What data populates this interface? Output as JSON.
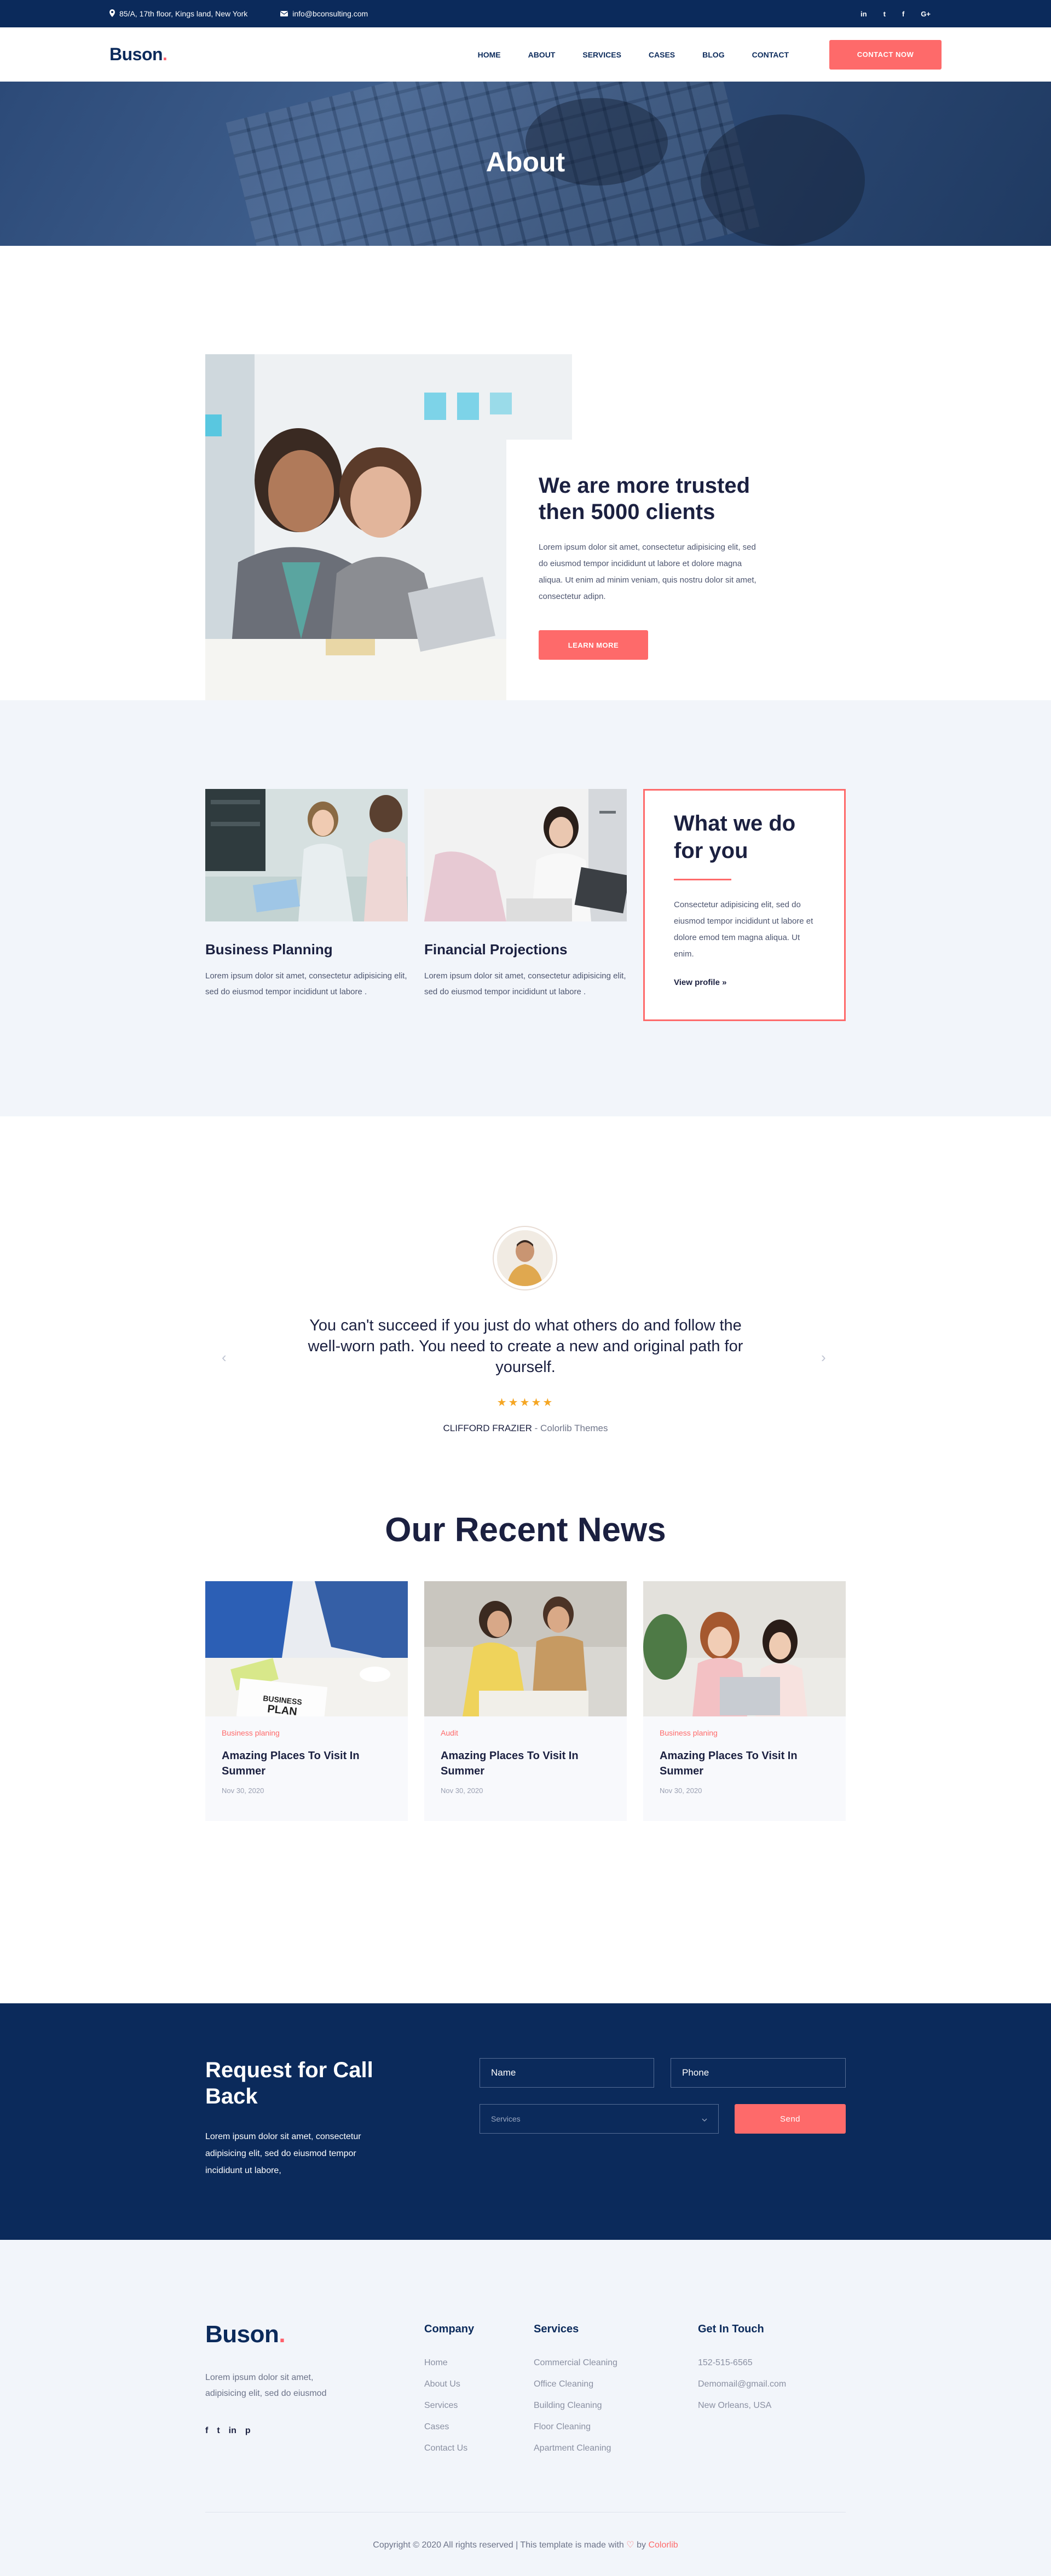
{
  "topbar": {
    "address": "85/A, 17th floor, Kings land, New York",
    "email": "info@bconsulting.com",
    "social": [
      "in",
      "t",
      "f",
      "G+"
    ]
  },
  "header": {
    "logo": "Buson",
    "logo_dot": ".",
    "nav": [
      "HOME",
      "ABOUT",
      "SERVICES",
      "CASES",
      "BLOG",
      "CONTACT"
    ],
    "cta": "CONTACT NOW"
  },
  "hero": {
    "title": "About"
  },
  "about": {
    "title": "We are more trusted then 5000 clients",
    "text": "Lorem ipsum dolor sit amet, consectetur adipisicing elit, sed do eiusmod tempor incididunt ut labore et dolore magna aliqua. Ut enim ad minim veniam, quis nostru dolor sit amet, consectetur adipn.",
    "button": "LEARN MORE"
  },
  "services": {
    "items": [
      {
        "title": "Business Planning",
        "text": "Lorem ipsum dolor sit amet, consectetur adipisicing elit, sed do eiusmod tempor incididunt ut labore ."
      },
      {
        "title": "Financial Projections",
        "text": "Lorem ipsum dolor sit amet, consectetur adipisicing elit, sed do eiusmod tempor incididunt ut labore ."
      }
    ],
    "whatwedo": {
      "title": "What we do for you",
      "text": "Consectetur adipisicing elit, sed do eiusmod tempor incididunt ut labore et dolore emod tem magna aliqua. Ut enim.",
      "link": "View profile »"
    }
  },
  "testimonial": {
    "quote": "You can't succeed if you just do what others do and follow the well-worn path. You need to create a new and original path for yourself.",
    "stars": "★★★★★",
    "rating": 5,
    "author": "CLIFFORD FRAZIER",
    "company": "- Colorlib Themes",
    "prev": "‹",
    "next": "›"
  },
  "news": {
    "title": "Our Recent News",
    "posts": [
      {
        "category": "Business planing",
        "title": "Amazing Places To Visit In Summer",
        "date": "Nov 30, 2020"
      },
      {
        "category": "Audit",
        "title": "Amazing Places To Visit In Summer",
        "date": "Nov 30, 2020"
      },
      {
        "category": "Business planing",
        "title": "Amazing Places To Visit In Summer",
        "date": "Nov 30, 2020"
      }
    ]
  },
  "callback": {
    "title": "Request for Call Back",
    "text": "Lorem ipsum dolor sit amet, consectetur adipisicing elit, sed do eiusmod tempor incididunt ut labore,",
    "name_placeholder": "Name",
    "phone_placeholder": "Phone",
    "services_select": "Services",
    "send": "Send"
  },
  "footer": {
    "logo": "Buson",
    "logo_dot": ".",
    "about": "Lorem ipsum dolor sit amet, adipisicing elit, sed do eiusmod",
    "socials": [
      "f",
      "t",
      "in",
      "p"
    ],
    "columns": [
      {
        "title": "Company",
        "links": [
          "Home",
          "About Us",
          "Services",
          "Cases",
          "Contact Us"
        ]
      },
      {
        "title": "Services",
        "links": [
          "Commercial Cleaning",
          "Office Cleaning",
          "Building Cleaning",
          "Floor Cleaning",
          "Apartment Cleaning"
        ]
      },
      {
        "title": "Get In Touch",
        "links": [
          "152-515-6565",
          "Demomail@gmail.com",
          "New Orleans, USA"
        ]
      }
    ],
    "copyright": "Copyright © 2020 All rights reserved | This template is made with",
    "heart": "♡",
    "by": "by",
    "brand": "Colorlib"
  },
  "colors": {
    "navy": "#0b2a5b",
    "accent": "#fe6a6a",
    "light_bg": "#f2f5fa",
    "star": "#f5a623"
  }
}
